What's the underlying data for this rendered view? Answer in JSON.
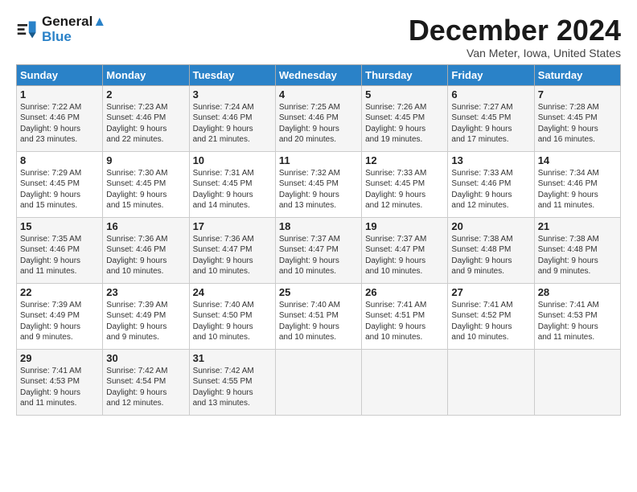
{
  "logo": {
    "line1": "General",
    "line2": "Blue"
  },
  "title": "December 2024",
  "subtitle": "Van Meter, Iowa, United States",
  "days_header": [
    "Sunday",
    "Monday",
    "Tuesday",
    "Wednesday",
    "Thursday",
    "Friday",
    "Saturday"
  ],
  "weeks": [
    [
      {
        "day": "1",
        "lines": [
          "Sunrise: 7:22 AM",
          "Sunset: 4:46 PM",
          "Daylight: 9 hours",
          "and 23 minutes."
        ]
      },
      {
        "day": "2",
        "lines": [
          "Sunrise: 7:23 AM",
          "Sunset: 4:46 PM",
          "Daylight: 9 hours",
          "and 22 minutes."
        ]
      },
      {
        "day": "3",
        "lines": [
          "Sunrise: 7:24 AM",
          "Sunset: 4:46 PM",
          "Daylight: 9 hours",
          "and 21 minutes."
        ]
      },
      {
        "day": "4",
        "lines": [
          "Sunrise: 7:25 AM",
          "Sunset: 4:46 PM",
          "Daylight: 9 hours",
          "and 20 minutes."
        ]
      },
      {
        "day": "5",
        "lines": [
          "Sunrise: 7:26 AM",
          "Sunset: 4:45 PM",
          "Daylight: 9 hours",
          "and 19 minutes."
        ]
      },
      {
        "day": "6",
        "lines": [
          "Sunrise: 7:27 AM",
          "Sunset: 4:45 PM",
          "Daylight: 9 hours",
          "and 17 minutes."
        ]
      },
      {
        "day": "7",
        "lines": [
          "Sunrise: 7:28 AM",
          "Sunset: 4:45 PM",
          "Daylight: 9 hours",
          "and 16 minutes."
        ]
      }
    ],
    [
      {
        "day": "8",
        "lines": [
          "Sunrise: 7:29 AM",
          "Sunset: 4:45 PM",
          "Daylight: 9 hours",
          "and 15 minutes."
        ]
      },
      {
        "day": "9",
        "lines": [
          "Sunrise: 7:30 AM",
          "Sunset: 4:45 PM",
          "Daylight: 9 hours",
          "and 15 minutes."
        ]
      },
      {
        "day": "10",
        "lines": [
          "Sunrise: 7:31 AM",
          "Sunset: 4:45 PM",
          "Daylight: 9 hours",
          "and 14 minutes."
        ]
      },
      {
        "day": "11",
        "lines": [
          "Sunrise: 7:32 AM",
          "Sunset: 4:45 PM",
          "Daylight: 9 hours",
          "and 13 minutes."
        ]
      },
      {
        "day": "12",
        "lines": [
          "Sunrise: 7:33 AM",
          "Sunset: 4:45 PM",
          "Daylight: 9 hours",
          "and 12 minutes."
        ]
      },
      {
        "day": "13",
        "lines": [
          "Sunrise: 7:33 AM",
          "Sunset: 4:46 PM",
          "Daylight: 9 hours",
          "and 12 minutes."
        ]
      },
      {
        "day": "14",
        "lines": [
          "Sunrise: 7:34 AM",
          "Sunset: 4:46 PM",
          "Daylight: 9 hours",
          "and 11 minutes."
        ]
      }
    ],
    [
      {
        "day": "15",
        "lines": [
          "Sunrise: 7:35 AM",
          "Sunset: 4:46 PM",
          "Daylight: 9 hours",
          "and 11 minutes."
        ]
      },
      {
        "day": "16",
        "lines": [
          "Sunrise: 7:36 AM",
          "Sunset: 4:46 PM",
          "Daylight: 9 hours",
          "and 10 minutes."
        ]
      },
      {
        "day": "17",
        "lines": [
          "Sunrise: 7:36 AM",
          "Sunset: 4:47 PM",
          "Daylight: 9 hours",
          "and 10 minutes."
        ]
      },
      {
        "day": "18",
        "lines": [
          "Sunrise: 7:37 AM",
          "Sunset: 4:47 PM",
          "Daylight: 9 hours",
          "and 10 minutes."
        ]
      },
      {
        "day": "19",
        "lines": [
          "Sunrise: 7:37 AM",
          "Sunset: 4:47 PM",
          "Daylight: 9 hours",
          "and 10 minutes."
        ]
      },
      {
        "day": "20",
        "lines": [
          "Sunrise: 7:38 AM",
          "Sunset: 4:48 PM",
          "Daylight: 9 hours",
          "and 9 minutes."
        ]
      },
      {
        "day": "21",
        "lines": [
          "Sunrise: 7:38 AM",
          "Sunset: 4:48 PM",
          "Daylight: 9 hours",
          "and 9 minutes."
        ]
      }
    ],
    [
      {
        "day": "22",
        "lines": [
          "Sunrise: 7:39 AM",
          "Sunset: 4:49 PM",
          "Daylight: 9 hours",
          "and 9 minutes."
        ]
      },
      {
        "day": "23",
        "lines": [
          "Sunrise: 7:39 AM",
          "Sunset: 4:49 PM",
          "Daylight: 9 hours",
          "and 9 minutes."
        ]
      },
      {
        "day": "24",
        "lines": [
          "Sunrise: 7:40 AM",
          "Sunset: 4:50 PM",
          "Daylight: 9 hours",
          "and 10 minutes."
        ]
      },
      {
        "day": "25",
        "lines": [
          "Sunrise: 7:40 AM",
          "Sunset: 4:51 PM",
          "Daylight: 9 hours",
          "and 10 minutes."
        ]
      },
      {
        "day": "26",
        "lines": [
          "Sunrise: 7:41 AM",
          "Sunset: 4:51 PM",
          "Daylight: 9 hours",
          "and 10 minutes."
        ]
      },
      {
        "day": "27",
        "lines": [
          "Sunrise: 7:41 AM",
          "Sunset: 4:52 PM",
          "Daylight: 9 hours",
          "and 10 minutes."
        ]
      },
      {
        "day": "28",
        "lines": [
          "Sunrise: 7:41 AM",
          "Sunset: 4:53 PM",
          "Daylight: 9 hours",
          "and 11 minutes."
        ]
      }
    ],
    [
      {
        "day": "29",
        "lines": [
          "Sunrise: 7:41 AM",
          "Sunset: 4:53 PM",
          "Daylight: 9 hours",
          "and 11 minutes."
        ]
      },
      {
        "day": "30",
        "lines": [
          "Sunrise: 7:42 AM",
          "Sunset: 4:54 PM",
          "Daylight: 9 hours",
          "and 12 minutes."
        ]
      },
      {
        "day": "31",
        "lines": [
          "Sunrise: 7:42 AM",
          "Sunset: 4:55 PM",
          "Daylight: 9 hours",
          "and 13 minutes."
        ]
      },
      null,
      null,
      null,
      null
    ]
  ]
}
